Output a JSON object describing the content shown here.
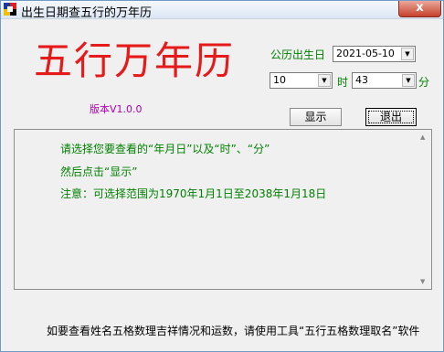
{
  "window": {
    "title": "出生日期查五行的万年历",
    "close_glyph": "x"
  },
  "logo": "五行万年历",
  "version": "版本V1.0.0",
  "birth": {
    "label": "公历出生日",
    "date_value": "2021-05-10",
    "hour_value": "10",
    "hour_unit": "时",
    "minute_value": "43",
    "minute_unit": "分"
  },
  "buttons": {
    "show": "显示",
    "exit": "退出"
  },
  "messages": [
    "请选择您要查看的“年月日”以及“时”、“分”",
    "然后点击“显示”",
    "注意：可选择范围为1970年1月1日至2038年1月18日"
  ],
  "footer": "如要查看姓名五格数理吉祥情况和运数，请使用工具“五行五格数理取名”软件",
  "colors": {
    "logo": "#e61a1a",
    "text_green": "#008000",
    "version": "#b000b0"
  }
}
